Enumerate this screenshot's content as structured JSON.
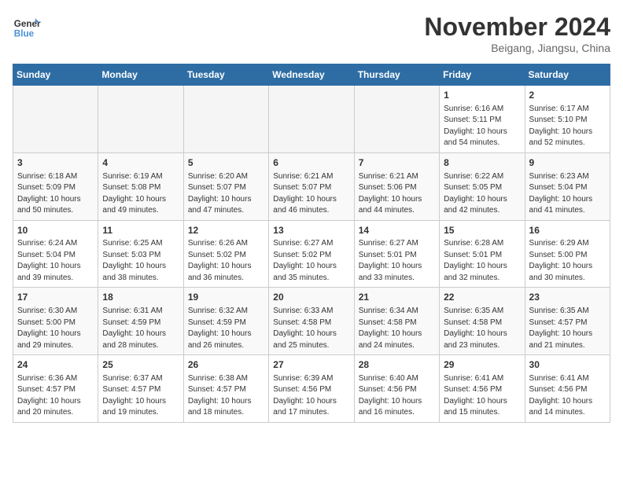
{
  "header": {
    "logo_line1": "General",
    "logo_line2": "Blue",
    "month_title": "November 2024",
    "location": "Beigang, Jiangsu, China"
  },
  "weekdays": [
    "Sunday",
    "Monday",
    "Tuesday",
    "Wednesday",
    "Thursday",
    "Friday",
    "Saturday"
  ],
  "weeks": [
    [
      {
        "day": "",
        "info": ""
      },
      {
        "day": "",
        "info": ""
      },
      {
        "day": "",
        "info": ""
      },
      {
        "day": "",
        "info": ""
      },
      {
        "day": "",
        "info": ""
      },
      {
        "day": "1",
        "info": "Sunrise: 6:16 AM\nSunset: 5:11 PM\nDaylight: 10 hours\nand 54 minutes."
      },
      {
        "day": "2",
        "info": "Sunrise: 6:17 AM\nSunset: 5:10 PM\nDaylight: 10 hours\nand 52 minutes."
      }
    ],
    [
      {
        "day": "3",
        "info": "Sunrise: 6:18 AM\nSunset: 5:09 PM\nDaylight: 10 hours\nand 50 minutes."
      },
      {
        "day": "4",
        "info": "Sunrise: 6:19 AM\nSunset: 5:08 PM\nDaylight: 10 hours\nand 49 minutes."
      },
      {
        "day": "5",
        "info": "Sunrise: 6:20 AM\nSunset: 5:07 PM\nDaylight: 10 hours\nand 47 minutes."
      },
      {
        "day": "6",
        "info": "Sunrise: 6:21 AM\nSunset: 5:07 PM\nDaylight: 10 hours\nand 46 minutes."
      },
      {
        "day": "7",
        "info": "Sunrise: 6:21 AM\nSunset: 5:06 PM\nDaylight: 10 hours\nand 44 minutes."
      },
      {
        "day": "8",
        "info": "Sunrise: 6:22 AM\nSunset: 5:05 PM\nDaylight: 10 hours\nand 42 minutes."
      },
      {
        "day": "9",
        "info": "Sunrise: 6:23 AM\nSunset: 5:04 PM\nDaylight: 10 hours\nand 41 minutes."
      }
    ],
    [
      {
        "day": "10",
        "info": "Sunrise: 6:24 AM\nSunset: 5:04 PM\nDaylight: 10 hours\nand 39 minutes."
      },
      {
        "day": "11",
        "info": "Sunrise: 6:25 AM\nSunset: 5:03 PM\nDaylight: 10 hours\nand 38 minutes."
      },
      {
        "day": "12",
        "info": "Sunrise: 6:26 AM\nSunset: 5:02 PM\nDaylight: 10 hours\nand 36 minutes."
      },
      {
        "day": "13",
        "info": "Sunrise: 6:27 AM\nSunset: 5:02 PM\nDaylight: 10 hours\nand 35 minutes."
      },
      {
        "day": "14",
        "info": "Sunrise: 6:27 AM\nSunset: 5:01 PM\nDaylight: 10 hours\nand 33 minutes."
      },
      {
        "day": "15",
        "info": "Sunrise: 6:28 AM\nSunset: 5:01 PM\nDaylight: 10 hours\nand 32 minutes."
      },
      {
        "day": "16",
        "info": "Sunrise: 6:29 AM\nSunset: 5:00 PM\nDaylight: 10 hours\nand 30 minutes."
      }
    ],
    [
      {
        "day": "17",
        "info": "Sunrise: 6:30 AM\nSunset: 5:00 PM\nDaylight: 10 hours\nand 29 minutes."
      },
      {
        "day": "18",
        "info": "Sunrise: 6:31 AM\nSunset: 4:59 PM\nDaylight: 10 hours\nand 28 minutes."
      },
      {
        "day": "19",
        "info": "Sunrise: 6:32 AM\nSunset: 4:59 PM\nDaylight: 10 hours\nand 26 minutes."
      },
      {
        "day": "20",
        "info": "Sunrise: 6:33 AM\nSunset: 4:58 PM\nDaylight: 10 hours\nand 25 minutes."
      },
      {
        "day": "21",
        "info": "Sunrise: 6:34 AM\nSunset: 4:58 PM\nDaylight: 10 hours\nand 24 minutes."
      },
      {
        "day": "22",
        "info": "Sunrise: 6:35 AM\nSunset: 4:58 PM\nDaylight: 10 hours\nand 23 minutes."
      },
      {
        "day": "23",
        "info": "Sunrise: 6:35 AM\nSunset: 4:57 PM\nDaylight: 10 hours\nand 21 minutes."
      }
    ],
    [
      {
        "day": "24",
        "info": "Sunrise: 6:36 AM\nSunset: 4:57 PM\nDaylight: 10 hours\nand 20 minutes."
      },
      {
        "day": "25",
        "info": "Sunrise: 6:37 AM\nSunset: 4:57 PM\nDaylight: 10 hours\nand 19 minutes."
      },
      {
        "day": "26",
        "info": "Sunrise: 6:38 AM\nSunset: 4:57 PM\nDaylight: 10 hours\nand 18 minutes."
      },
      {
        "day": "27",
        "info": "Sunrise: 6:39 AM\nSunset: 4:56 PM\nDaylight: 10 hours\nand 17 minutes."
      },
      {
        "day": "28",
        "info": "Sunrise: 6:40 AM\nSunset: 4:56 PM\nDaylight: 10 hours\nand 16 minutes."
      },
      {
        "day": "29",
        "info": "Sunrise: 6:41 AM\nSunset: 4:56 PM\nDaylight: 10 hours\nand 15 minutes."
      },
      {
        "day": "30",
        "info": "Sunrise: 6:41 AM\nSunset: 4:56 PM\nDaylight: 10 hours\nand 14 minutes."
      }
    ]
  ]
}
